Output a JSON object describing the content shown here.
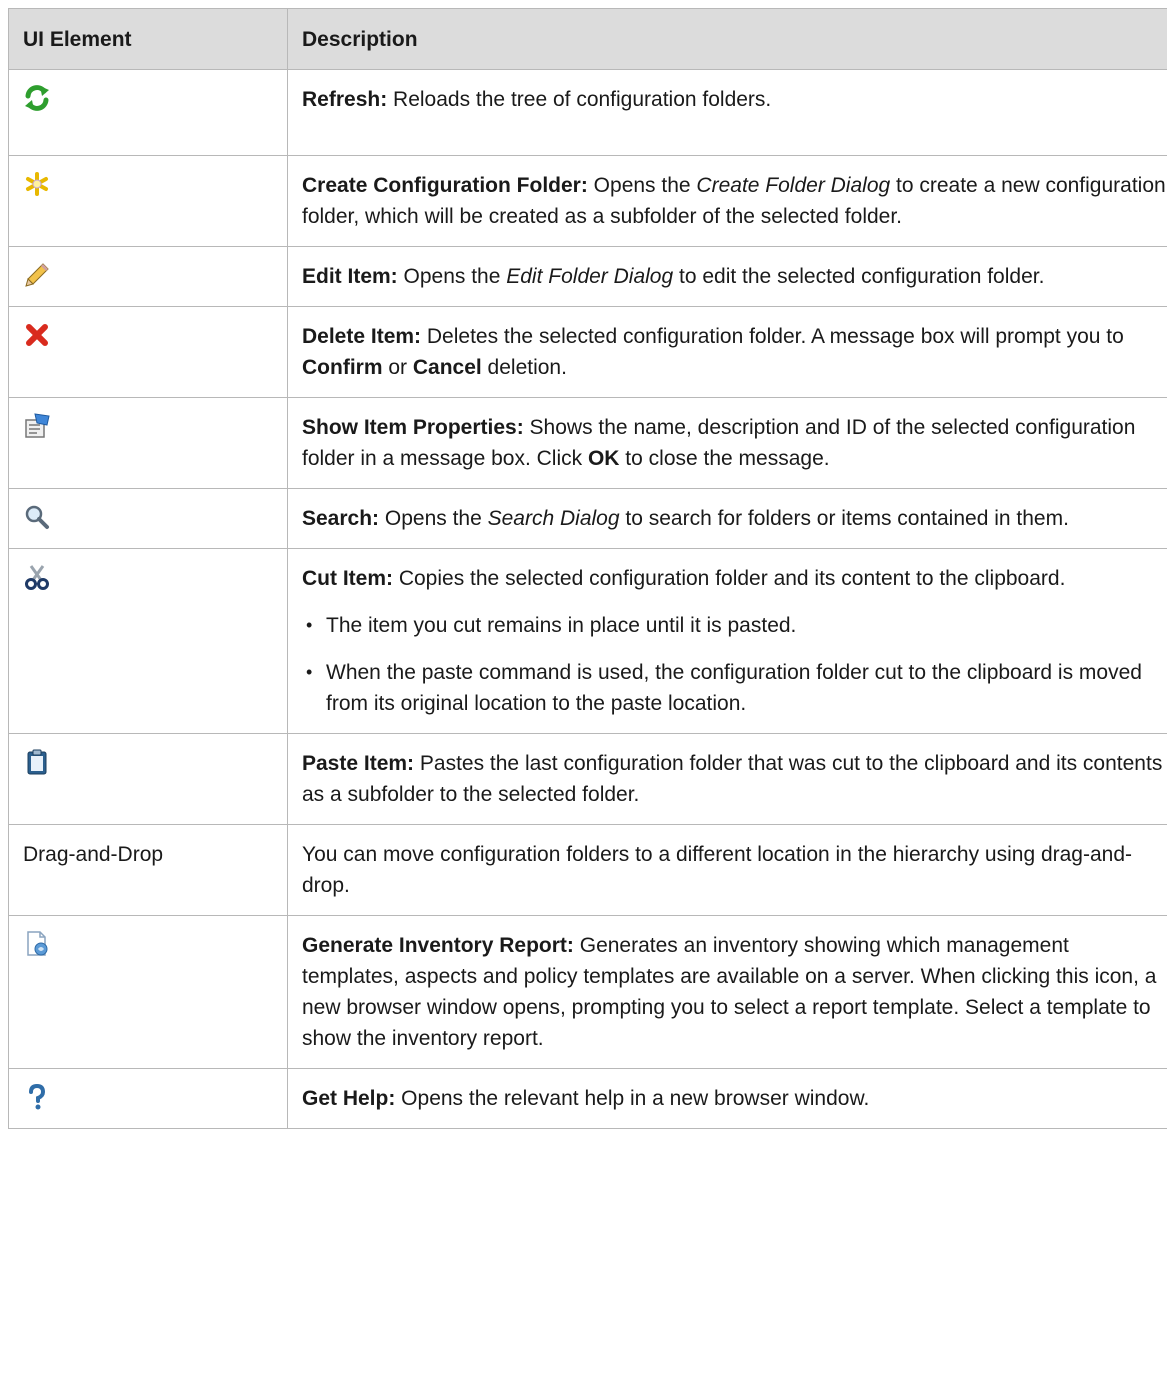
{
  "header": {
    "col1": "UI Element",
    "col2": "Description"
  },
  "rows": {
    "refresh": {
      "icon": "refresh-icon",
      "name": "Refresh:",
      "desc": " Reloads the tree of configuration folders."
    },
    "create": {
      "icon": "create-folder-icon",
      "name": "Create Configuration Folder:",
      "t1": " Opens the ",
      "dialog": "Create Folder Dialog",
      "t2": " to create a new configuration folder, which will be created as a subfolder of the selected folder."
    },
    "edit": {
      "icon": "pencil-icon",
      "name": "Edit Item:",
      "t1": " Opens the ",
      "dialog": "Edit Folder Dialog",
      "t2": " to edit the selected configuration folder."
    },
    "delete": {
      "icon": "delete-icon",
      "name": "Delete Item:",
      "t1": " Deletes the selected configuration folder. A message box will prompt you to ",
      "confirm": "Confirm",
      "t2": " or ",
      "cancel": "Cancel",
      "t3": " deletion."
    },
    "props": {
      "icon": "properties-icon",
      "name": "Show Item Properties:",
      "t1": " Shows the name, description and ID of the selected configuration folder in a message box. Click ",
      "ok": "OK",
      "t2": " to close the message."
    },
    "search": {
      "icon": "search-icon",
      "name": "Search:",
      "t1": " Opens the ",
      "dialog": "Search Dialog",
      "t2": " to search for folders or items contained in them."
    },
    "cut": {
      "icon": "scissors-icon",
      "name": "Cut Item:",
      "desc": " Copies the selected configuration folder and its content to the clipboard.",
      "bullets": [
        "The item you cut remains in place until it is pasted.",
        "When the paste command is used, the configuration folder cut to the clipboard is moved from its original location to the paste location."
      ]
    },
    "paste": {
      "icon": "clipboard-icon",
      "name": "Paste Item:",
      "desc": " Pastes the last configuration folder that was cut to the clipboard and its contents as a subfolder to the selected folder."
    },
    "drag": {
      "label": "Drag-and-Drop",
      "desc": "You can move configuration folders to a different location in the hierarchy using drag-and-drop."
    },
    "report": {
      "icon": "inventory-report-icon",
      "name": "Generate Inventory Report:",
      "desc": " Generates an inventory showing which management templates, aspects and policy templates are available on a server. When clicking this icon, a new browser window opens, prompting you to select a report template. Select a template to show the inventory report."
    },
    "help": {
      "icon": "help-icon",
      "name": "Get Help:",
      "desc": " Opens the relevant help in a new browser window."
    }
  }
}
